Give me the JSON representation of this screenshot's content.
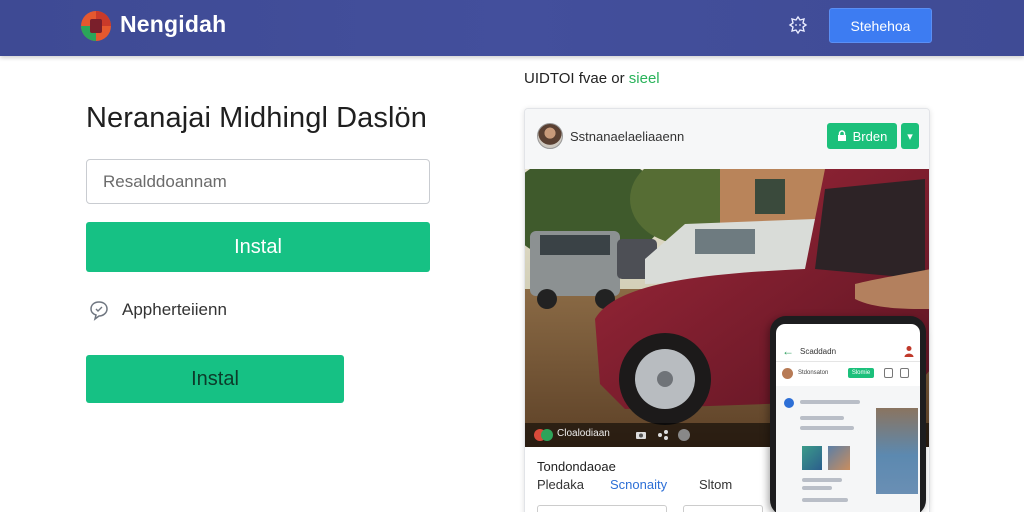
{
  "header": {
    "brand": "Nengidah",
    "signin_label": "Stehehoa"
  },
  "left": {
    "title": "Neranajai Midhingl Daslön",
    "search_placeholder": "Resalddoannam",
    "install_primary": "Instal",
    "app_label": "Appherteiienn",
    "install_secondary": "Instal"
  },
  "right": {
    "heading_main": "UIDTOI fvae or ",
    "heading_accent": "sieel",
    "card": {
      "name": "Sstnanaelaeliaaenn",
      "order_label": "Brden",
      "photo_bar_label": "Cloalodiaan",
      "info_title": "Tondondaoae",
      "tab_a": "Pledaka",
      "tab_b": "Scnonaity",
      "tab_c": "Sltom"
    },
    "phone": {
      "back_glyph": "←",
      "title": "Scaddadn",
      "row_name": "Stdonsaton",
      "green_label": "Slomie"
    }
  },
  "colors": {
    "header": "#3e4a94",
    "primary_button": "#16c184",
    "signin_button": "#3d7cf2",
    "accent_green": "#29b35a",
    "link_blue": "#2d6fd6"
  }
}
